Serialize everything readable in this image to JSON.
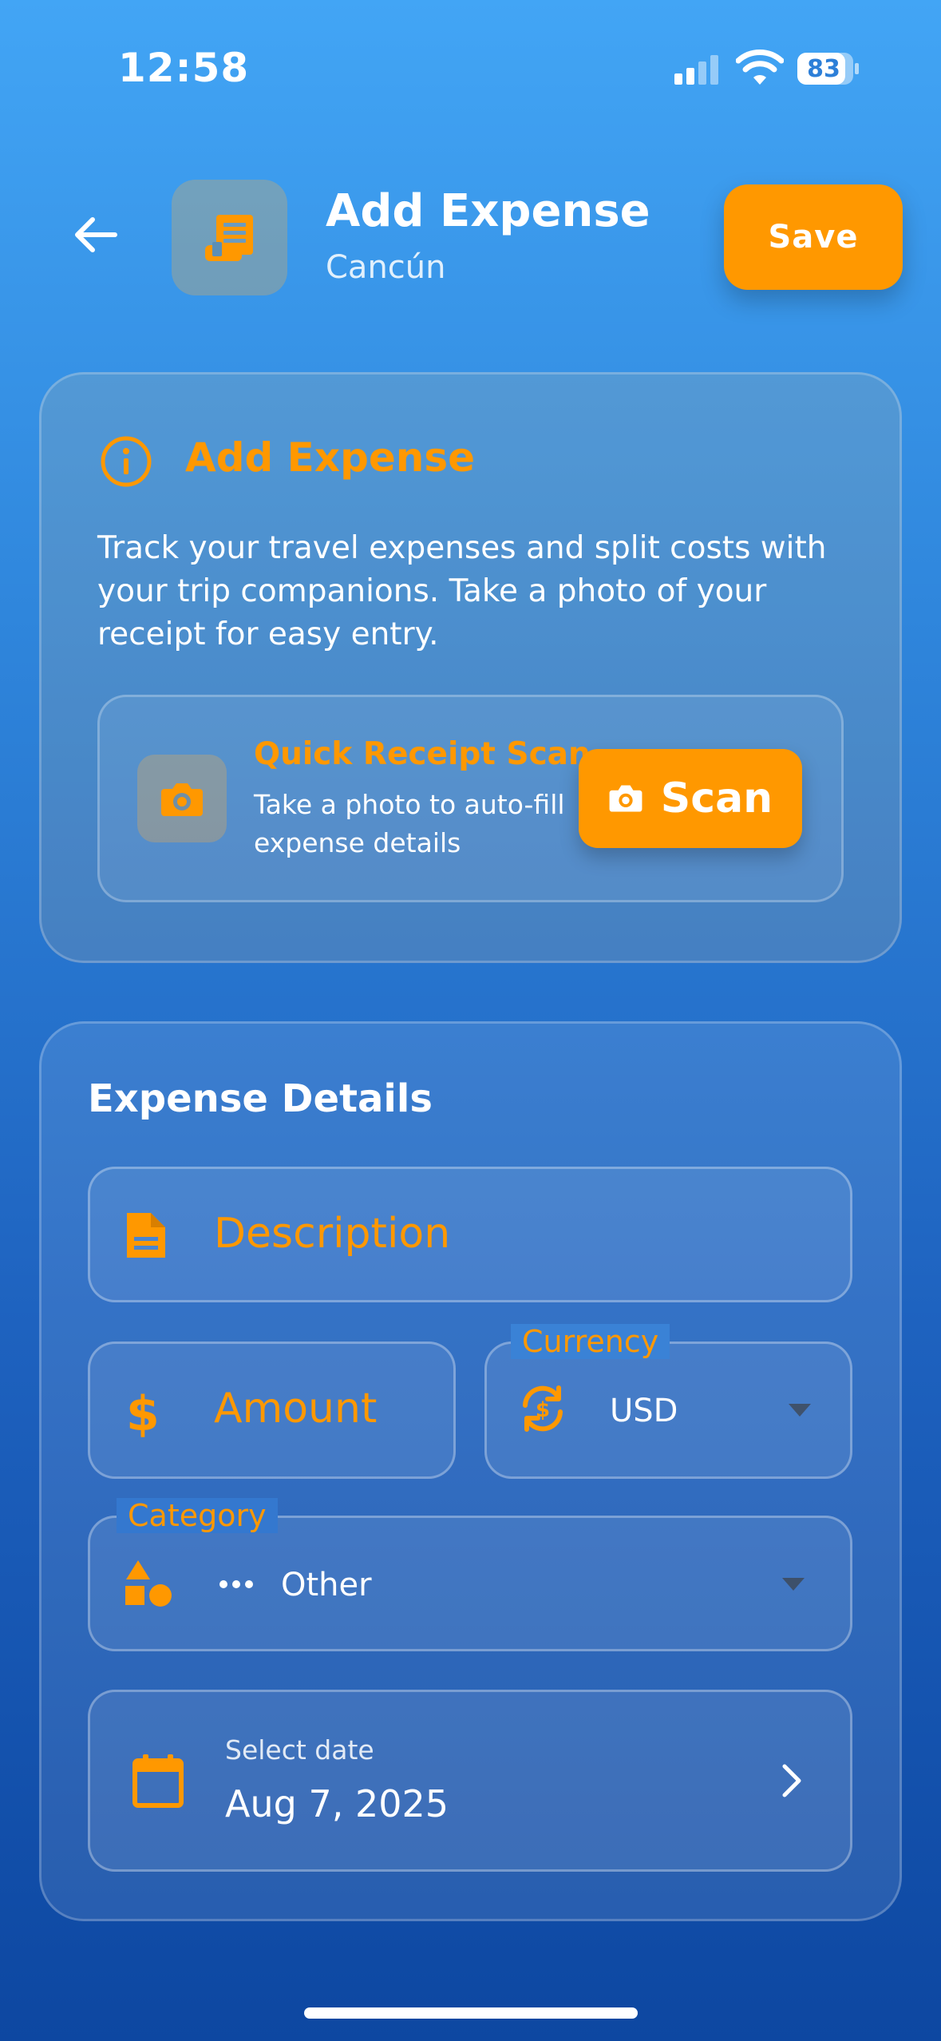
{
  "status_bar": {
    "time": "12:58",
    "battery_level": "83"
  },
  "header": {
    "title": "Add Expense",
    "subtitle": "Cancún",
    "save_label": "Save"
  },
  "info_card": {
    "title": "Add Expense",
    "description": "Track your travel expenses and split costs with your trip companions. Take a photo of your receipt for easy entry.",
    "scan": {
      "title": "Quick Receipt Scan",
      "subtitle": "Take a photo to auto-fill expense details",
      "button_label": "Scan"
    }
  },
  "details": {
    "title": "Expense Details",
    "description_placeholder": "Description",
    "amount_placeholder": "Amount",
    "currency": {
      "label": "Currency",
      "value": "USD"
    },
    "category": {
      "label": "Category",
      "value": "Other"
    },
    "date": {
      "label": "Select date",
      "value": "Aug 7, 2025"
    }
  },
  "icons": {
    "back": "arrow-left-icon",
    "header": "receipt-icon",
    "info": "info-circle-icon",
    "camera": "camera-icon",
    "description": "document-icon",
    "amount": "dollar-icon",
    "currency": "currency-exchange-icon",
    "category": "shapes-icon",
    "date": "calendar-icon"
  },
  "colors": {
    "accent": "#ff9800",
    "background_top": "#42a5f5",
    "background_bottom": "#0d47a1"
  }
}
